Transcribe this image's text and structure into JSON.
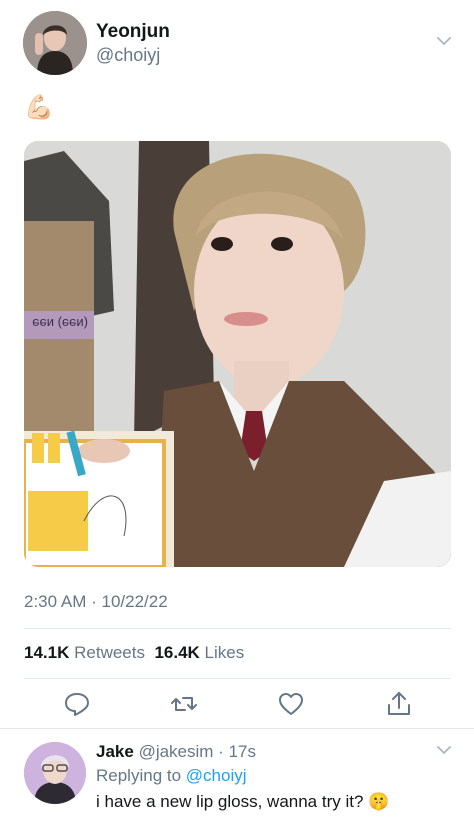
{
  "author": {
    "name": "Yeonjun",
    "handle": "@choiyj"
  },
  "tweet": {
    "text": "💪🏻",
    "time": "2:30 AM",
    "separator": " · ",
    "date": "10/22/22"
  },
  "stats": {
    "retweets_count": "14.1K",
    "retweets_label": "Retweets",
    "likes_count": "16.4K",
    "likes_label": "Likes"
  },
  "actions": [
    "reply-icon",
    "retweet-icon",
    "like-icon",
    "share-icon"
  ],
  "reply": {
    "name": "Jake",
    "handle": "@jakesim",
    "age": "17s",
    "replying_to_label": "Replying to",
    "replying_to_handle": "@choiyj",
    "text": "i have a new lip gloss, wanna try it? 🤫"
  },
  "colors": {
    "link": "#1da1f2",
    "secondary_text": "#657786",
    "divider": "#e1e8ed"
  }
}
